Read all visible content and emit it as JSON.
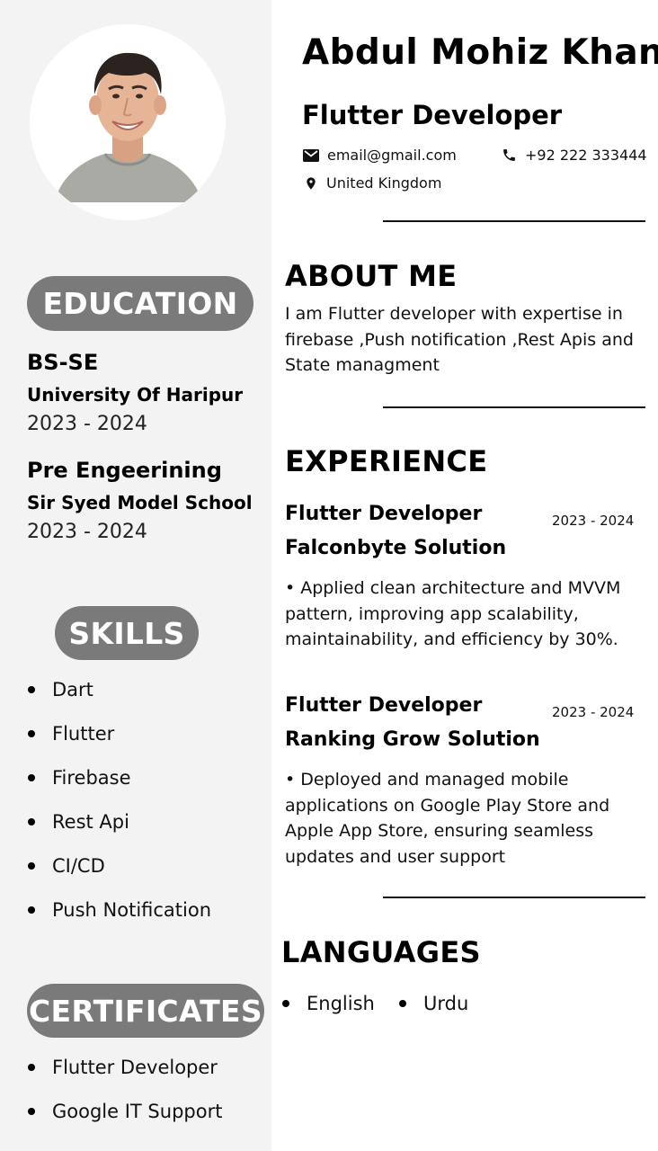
{
  "profile": {
    "name": "Abdul Mohiz Khan",
    "title": "Flutter Developer",
    "email": "email@gmail.com",
    "phone": "+92 222 333444",
    "location": "United Kingdom"
  },
  "education": {
    "heading": "EDUCATION",
    "items": [
      {
        "degree": "BS-SE",
        "school": "University Of Haripur",
        "years": "2023 - 2024"
      },
      {
        "degree": "Pre Engeerining",
        "school": "Sir Syed Model School",
        "years": "2023 - 2024"
      }
    ]
  },
  "skills": {
    "heading": "SKILLS",
    "items": [
      "Dart",
      "Flutter",
      "Firebase",
      "Rest Api",
      "CI/CD",
      "Push Notification"
    ]
  },
  "certificates": {
    "heading": "CERTIFICATES",
    "items": [
      "Flutter Developer",
      "Google IT Support"
    ]
  },
  "about": {
    "heading": "ABOUT ME",
    "text": "I am Flutter developer with expertise in firebase ,Push notification ,Rest Apis and State managment"
  },
  "experience": {
    "heading": "EXPERIENCE",
    "items": [
      {
        "role": "Flutter Developer",
        "company": "Falconbyte Solution",
        "years": "2023 - 2024",
        "description": "• Applied clean architecture and MVVM pattern, improving app scalability, maintainability, and efficiency by 30%."
      },
      {
        "role": "Flutter Developer",
        "company": "Ranking Grow Solution",
        "years": "2023 - 2024",
        "description": "• Deployed and managed mobile applications on Google Play Store and Apple App Store, ensuring seamless updates and user support"
      }
    ]
  },
  "languages": {
    "heading": "LANGUAGES",
    "items": [
      "English",
      "Urdu"
    ]
  },
  "icons": {
    "email": "email-icon",
    "phone": "phone-icon",
    "location": "location-pin-icon"
  }
}
